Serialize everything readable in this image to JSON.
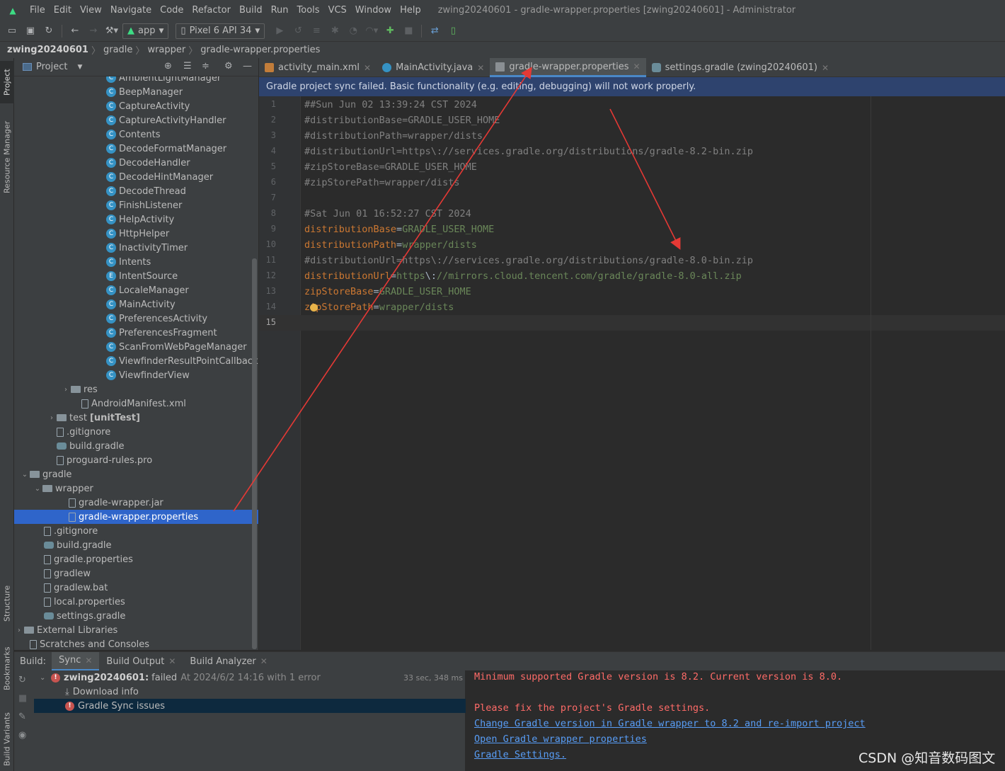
{
  "menu": {
    "items": [
      "File",
      "Edit",
      "View",
      "Navigate",
      "Code",
      "Refactor",
      "Build",
      "Run",
      "Tools",
      "VCS",
      "Window",
      "Help"
    ],
    "window_title": "zwing20240601 - gradle-wrapper.properties [zwing20240601] - Administrator"
  },
  "toolbar": {
    "run_config": "app",
    "device": "Pixel 6 API 34"
  },
  "breadcrumb": [
    "zwing20240601",
    "gradle",
    "wrapper",
    "gradle-wrapper.properties"
  ],
  "stripe": {
    "project": "Project",
    "resource_manager": "Resource Manager",
    "structure": "Structure",
    "bookmarks": "Bookmarks",
    "build_variants": "Build Variants"
  },
  "project": {
    "view_label": "Project",
    "tree": [
      {
        "label": "AmbientLightManager",
        "icon": "class-icon"
      },
      {
        "label": "BeepManager",
        "icon": "class-icon"
      },
      {
        "label": "CaptureActivity",
        "icon": "class-icon"
      },
      {
        "label": "CaptureActivityHandler",
        "icon": "class-icon"
      },
      {
        "label": "Contents",
        "icon": "class-icon"
      },
      {
        "label": "DecodeFormatManager",
        "icon": "class-icon"
      },
      {
        "label": "DecodeHandler",
        "icon": "class-icon"
      },
      {
        "label": "DecodeHintManager",
        "icon": "class-icon"
      },
      {
        "label": "DecodeThread",
        "icon": "class-icon"
      },
      {
        "label": "FinishListener",
        "icon": "class-icon"
      },
      {
        "label": "HelpActivity",
        "icon": "class-icon"
      },
      {
        "label": "HttpHelper",
        "icon": "class-icon"
      },
      {
        "label": "InactivityTimer",
        "icon": "class-icon"
      },
      {
        "label": "Intents",
        "icon": "class-icon"
      },
      {
        "label": "IntentSource",
        "icon": "enum-icon"
      },
      {
        "label": "LocaleManager",
        "icon": "class-icon"
      },
      {
        "label": "MainActivity",
        "icon": "class-icon"
      },
      {
        "label": "PreferencesActivity",
        "icon": "class-icon"
      },
      {
        "label": "PreferencesFragment",
        "icon": "class-icon"
      },
      {
        "label": "ScanFromWebPageManager",
        "icon": "class-icon"
      },
      {
        "label": "ViewfinderResultPointCallback",
        "icon": "class-icon"
      },
      {
        "label": "ViewfinderView",
        "icon": "class-icon"
      },
      {
        "label": "res",
        "icon": "folder-icon"
      },
      {
        "label": "AndroidManifest.xml",
        "icon": "file-icon"
      },
      {
        "label": "test",
        "suffix": "[unitTest]",
        "icon": "folder-icon"
      },
      {
        "label": ".gitignore",
        "icon": "file-icon"
      },
      {
        "label": "build.gradle",
        "icon": "gradle-icon"
      },
      {
        "label": "proguard-rules.pro",
        "icon": "file-icon"
      },
      {
        "label": "gradle",
        "icon": "folder-icon"
      },
      {
        "label": "wrapper",
        "icon": "folder-icon"
      },
      {
        "label": "gradle-wrapper.jar",
        "icon": "file-icon"
      },
      {
        "label": "gradle-wrapper.properties",
        "icon": "file-icon"
      },
      {
        "label": ".gitignore",
        "icon": "file-icon"
      },
      {
        "label": "build.gradle",
        "icon": "gradle-icon"
      },
      {
        "label": "gradle.properties",
        "icon": "file-icon"
      },
      {
        "label": "gradlew",
        "icon": "file-icon"
      },
      {
        "label": "gradlew.bat",
        "icon": "file-icon"
      },
      {
        "label": "local.properties",
        "icon": "file-icon"
      },
      {
        "label": "settings.gradle",
        "icon": "gradle-icon"
      },
      {
        "label": "External Libraries",
        "icon": "library-icon"
      },
      {
        "label": "Scratches and Consoles",
        "icon": "scratch-icon"
      }
    ]
  },
  "editor": {
    "tabs": [
      "activity_main.xml",
      "MainActivity.java",
      "gradle-wrapper.properties",
      "settings.gradle (zwing20240601)"
    ],
    "notice": "Gradle project sync failed. Basic functionality (e.g. editing, debugging) will not work properly.",
    "lines": [
      {
        "n": "1",
        "parts": [
          {
            "t": "##Sun Jun 02 13:39:24 CST 2024",
            "c": "cmt"
          }
        ]
      },
      {
        "n": "2",
        "parts": [
          {
            "t": "#distributionBase=GRADLE_USER_HOME",
            "c": "cmt"
          }
        ]
      },
      {
        "n": "3",
        "parts": [
          {
            "t": "#distributionPath=wrapper/dists",
            "c": "cmt"
          }
        ]
      },
      {
        "n": "4",
        "parts": [
          {
            "t": "#distributionUrl=https\\://services.gradle.org/distributions/gradle-8.2-bin.zip",
            "c": "cmt"
          }
        ]
      },
      {
        "n": "5",
        "parts": [
          {
            "t": "#zipStoreBase=GRADLE_USER_HOME",
            "c": "cmt"
          }
        ]
      },
      {
        "n": "6",
        "parts": [
          {
            "t": "#zipStorePath=wrapper/dists",
            "c": "cmt"
          }
        ]
      },
      {
        "n": "7",
        "parts": []
      },
      {
        "n": "8",
        "parts": [
          {
            "t": "#Sat Jun 01 16:52:27 CST 2024",
            "c": "cmt"
          }
        ]
      },
      {
        "n": "9",
        "parts": [
          {
            "t": "distributionBase",
            "c": "key"
          },
          {
            "t": "=",
            "c": "eq"
          },
          {
            "t": "GRADLE_USER_HOME",
            "c": "val"
          }
        ]
      },
      {
        "n": "10",
        "parts": [
          {
            "t": "distributionPath",
            "c": "key"
          },
          {
            "t": "=",
            "c": "eq"
          },
          {
            "t": "wrapper/dists",
            "c": "val"
          }
        ]
      },
      {
        "n": "11",
        "parts": [
          {
            "t": "#distributionUrl=https\\://services.gradle.org/distributions/gradle-8.0-bin.zip",
            "c": "cmt"
          }
        ]
      },
      {
        "n": "12",
        "parts": [
          {
            "t": "distributionUrl",
            "c": "key"
          },
          {
            "t": "=",
            "c": "eq"
          },
          {
            "t": "https",
            "c": "val"
          },
          {
            "t": "\\:",
            "c": "eq"
          },
          {
            "t": "//mirrors.cloud.tencent.com/gradle/gradle-8.0-all.zip",
            "c": "val"
          }
        ]
      },
      {
        "n": "13",
        "parts": [
          {
            "t": "zipStoreBase",
            "c": "key"
          },
          {
            "t": "=",
            "c": "eq"
          },
          {
            "t": "GRADLE_USER_HOME",
            "c": "val"
          }
        ]
      },
      {
        "n": "14",
        "parts": [
          {
            "t": "zipStorePath",
            "c": "key"
          },
          {
            "t": "=",
            "c": "eq"
          },
          {
            "t": "wrapper/dists",
            "c": "val"
          }
        ]
      },
      {
        "n": "15",
        "parts": []
      }
    ]
  },
  "build": {
    "label": "Build:",
    "tabs": [
      "Sync",
      "Build Output",
      "Build Analyzer"
    ],
    "root_name": "zwing20240601:",
    "root_status": "failed",
    "root_detail": "At 2024/6/2 14:16 with 1 error",
    "duration": "33 sec, 348 ms",
    "items": [
      "Download info",
      "Gradle Sync issues"
    ],
    "output": {
      "error_line": "Minimum supported Gradle version is 8.2. Current version is 8.0.",
      "fix_line": "Please fix the project's Gradle settings.",
      "links": [
        "Change Gradle version in Gradle wrapper to 8.2 and re-import project",
        "Open Gradle wrapper properties",
        "Gradle Settings."
      ]
    }
  },
  "watermark": "CSDN @知音数码图文",
  "colors": {
    "selection": "#2f65ca",
    "annotation_arrow": "#e53935",
    "link": "#589df6",
    "error": "#ff6b68"
  }
}
